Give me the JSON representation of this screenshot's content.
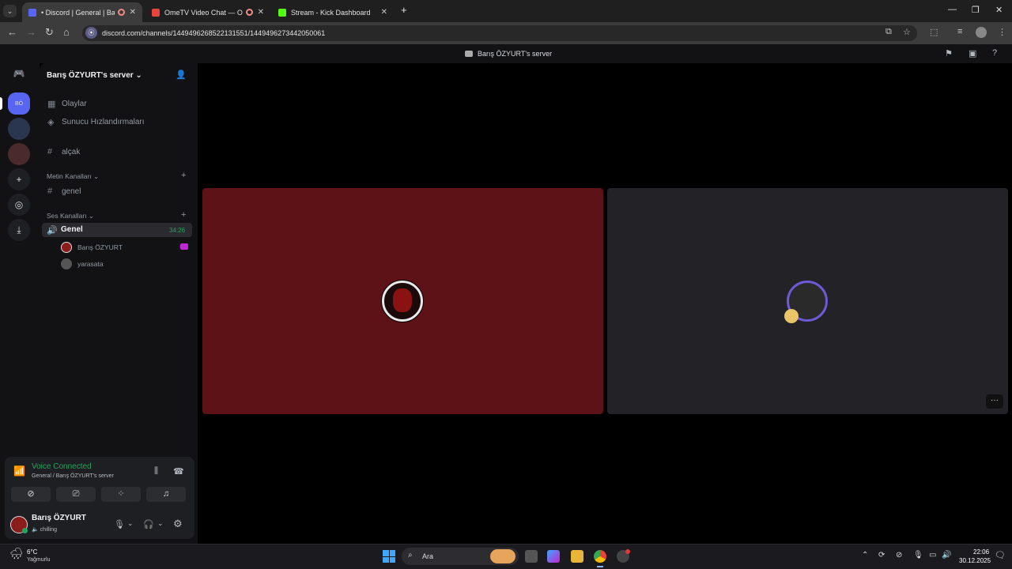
{
  "browser": {
    "tabs": [
      {
        "title": "• Discord | General | Barış Ö",
        "active": true
      },
      {
        "title": "OmeTV Video Chat — Ome",
        "active": false
      },
      {
        "title": "Stream - Kick Dashboard",
        "active": false
      }
    ],
    "url": "discord.com/channels/1449496268522131551/1449496273442050061"
  },
  "discord": {
    "top_title": "Barış ÖZYURT's server",
    "server_name": "Barış ÖZYURT's server",
    "nav": {
      "events": "Olaylar",
      "boosts": "Sunucu Hızlandırmaları"
    },
    "channels": {
      "alcak": "alçak",
      "text_category": "Metin Kanalları",
      "genel_text": "genel",
      "voice_category": "Ses Kanalları",
      "genel_voice": "Genel",
      "voice_timer": "34:26",
      "voice_users": [
        "Barış ÖZYURT",
        "yarasata"
      ]
    },
    "voice_status": {
      "title": "Voice Connected",
      "subtitle": "General / Barış ÖZYURT's server"
    },
    "user": {
      "name": "Barış ÖZYURT",
      "status": "chilling"
    }
  },
  "taskbar": {
    "weather_temp": "6°C",
    "weather_desc": "Yağmurlu",
    "search": "Ara",
    "time": "22:06",
    "date": "30.12.2025"
  },
  "colors": {
    "accent_green": "#23a55a",
    "tile_red": "#5c1216",
    "tile_dark": "#232227"
  }
}
